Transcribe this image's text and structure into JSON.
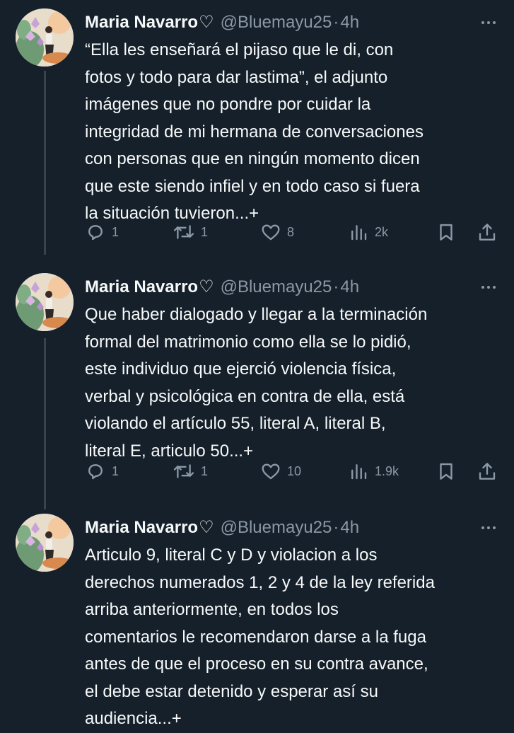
{
  "tweets": [
    {
      "author_name": "Maria Navarro",
      "heart": "♡",
      "handle": "@Bluemayu25",
      "separator": "·",
      "time": "4h",
      "lines": [
        "“Ella les enseñará el pijaso que le di, con",
        "fotos y todo para dar lastima”, el adjunto",
        "imágenes que no pondre por cuidar la",
        "integridad de mi hermana de conversaciones",
        "con personas que en ningún momento dicen",
        "que este siendo infiel y en todo caso si fuera",
        "la situación tuvieron...+"
      ],
      "replies": "1",
      "reposts": "1",
      "likes": "8",
      "views": "2k"
    },
    {
      "author_name": "Maria Navarro",
      "heart": "♡",
      "handle": "@Bluemayu25",
      "separator": "·",
      "time": "4h",
      "lines": [
        "Que haber dialogado y llegar a la terminación",
        "formal del matrimonio como ella se lo pidió,",
        "este individuo que ejerció violencia física,",
        "verbal y psicológica en contra de ella, está",
        "violando el artículo 55, literal A, literal B,",
        "literal E, articulo 50...+"
      ],
      "replies": "1",
      "reposts": "1",
      "likes": "10",
      "views": "1.9k"
    },
    {
      "author_name": "Maria Navarro",
      "heart": "♡",
      "handle": "@Bluemayu25",
      "separator": "·",
      "time": "4h",
      "lines": [
        "Articulo 9, literal C y D y violacion a los",
        "derechos numerados 1, 2 y 4 de la ley referida",
        "arriba anteriormente, en todos los",
        "comentarios le recomendaron darse a la fuga",
        "antes de que el proceso en su contra avance,",
        "el debe estar detenido y esperar así su",
        "audiencia...+"
      ]
    }
  ],
  "icons": {
    "reply": "reply-icon",
    "repost": "repost-icon",
    "like": "heart-icon",
    "views": "views-icon",
    "bookmark": "bookmark-icon",
    "share": "share-icon",
    "more": "more-icon"
  },
  "colors": {
    "background": "#15202b",
    "text": "#f7f9f9",
    "muted": "#8b98a5",
    "thread_line": "#38444d"
  }
}
